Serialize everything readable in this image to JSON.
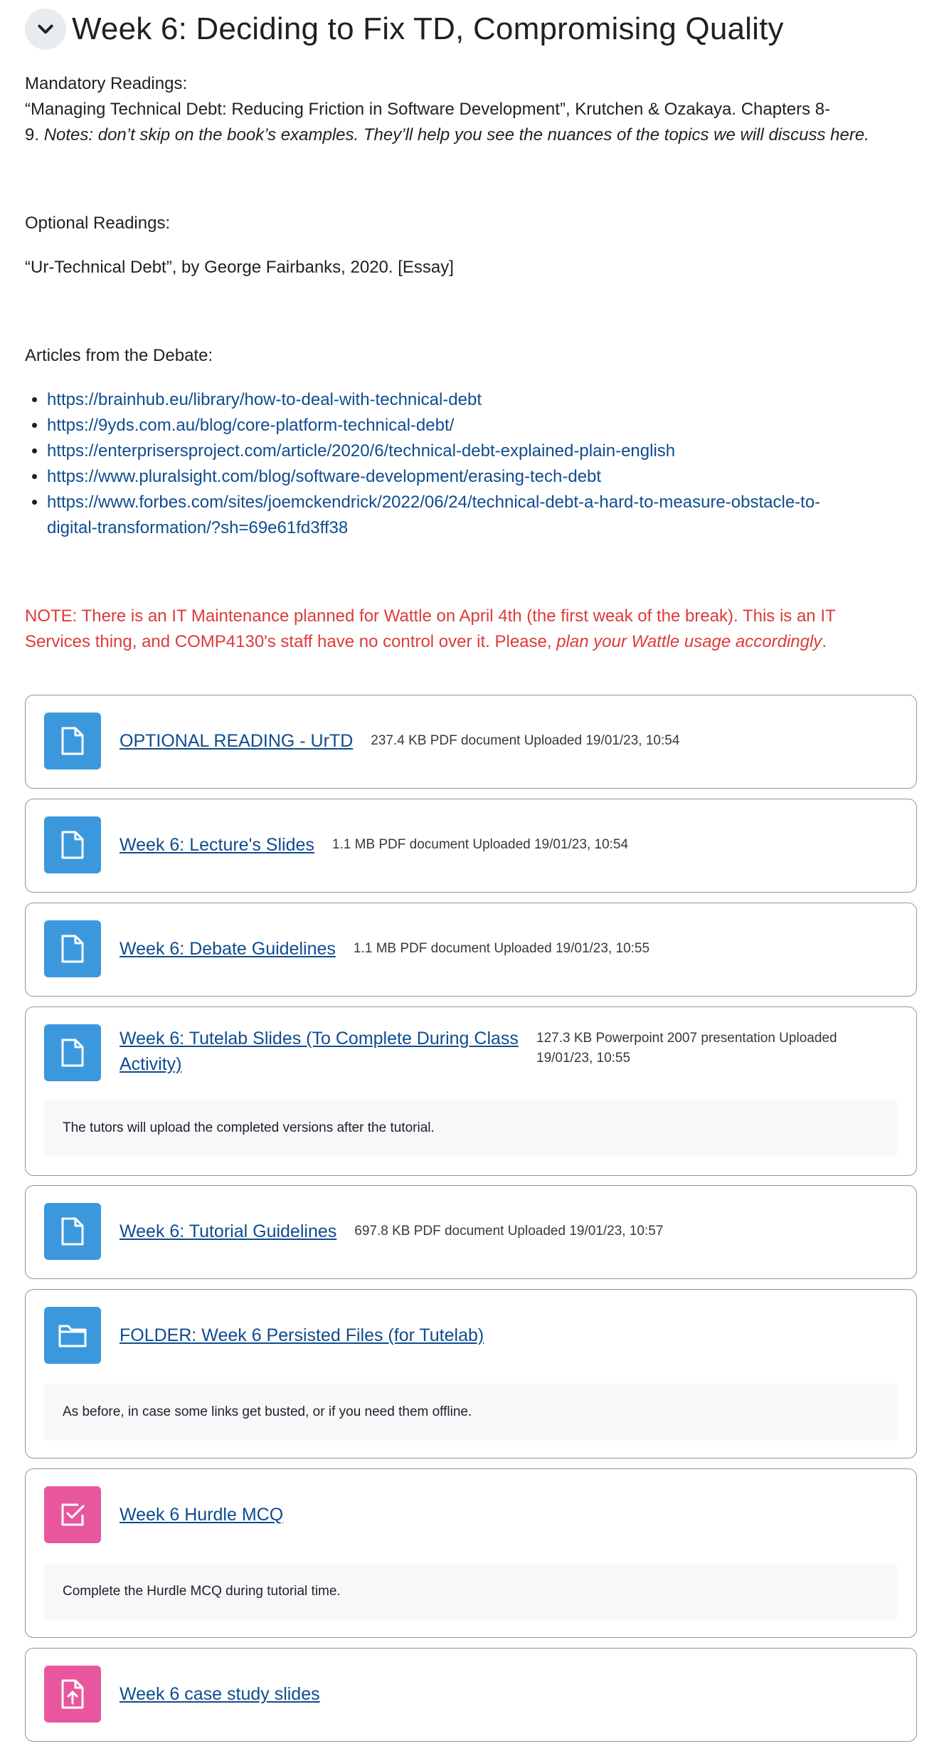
{
  "section": {
    "title": "Week 6: Deciding to Fix TD, Compromising Quality"
  },
  "mandatory": {
    "heading": "Mandatory Readings:",
    "line1": "“Managing Technical Debt: Reducing Friction in Software Development”, Krutchen & Ozakaya. Chapters 8-",
    "line2_prefix": "9. ",
    "line2_note": "Notes: don’t skip on the book’s examples. They’ll help you see the nuances of the topics we will discuss here."
  },
  "optional": {
    "heading": "Optional Readings:",
    "item": "“Ur-Technical Debt”, by George Fairbanks, 2020. [Essay]"
  },
  "debate": {
    "heading": "Articles from the Debate:",
    "links": [
      {
        "line1": "https://brainhub.eu/library/how-to-deal-with-technical-debt",
        "line2": ""
      },
      {
        "line1": "https://9yds.com.au/blog/core-platform-technical-debt/",
        "line2": ""
      },
      {
        "line1": "https://enterprisersproject.com/article/2020/6/technical-debt-explained-plain-english",
        "line2": ""
      },
      {
        "line1": "https://www.pluralsight.com/blog/software-development/erasing-tech-debt",
        "line2": ""
      },
      {
        "line1": "https://www.forbes.com/sites/joemckendrick/2022/06/24/technical-debt-a-hard-to-measure-obstacle-to-",
        "line2": "digital-transformation/?sh=69e61fd3ff38"
      }
    ]
  },
  "note": {
    "line1": "NOTE: There is an IT Maintenance planned for Wattle on April 4th (the first weak of the break). This is an IT",
    "line2_prefix": "Services thing, and COMP4130's staff have no control over it. Please, ",
    "line2_italic": "plan your Wattle usage accordingly",
    "line2_suffix": "."
  },
  "activities": [
    {
      "name": "OPTIONAL READING - UrTD",
      "meta": "237.4 KB PDF document Uploaded 19/01/23, 10:54",
      "icon": "file-icon"
    },
    {
      "name": "Week 6: Lecture's Slides",
      "meta": "1.1 MB PDF document Uploaded 19/01/23, 10:54",
      "icon": "file-icon"
    },
    {
      "name": "Week 6: Debate Guidelines",
      "meta": "1.1 MB PDF document Uploaded 19/01/23, 10:55",
      "icon": "file-icon"
    },
    {
      "name_line1": "Week 6: Tutelab Slides (To Complete During Class",
      "name_line2": "Activity)",
      "meta_line1": "127.3 KB Powerpoint 2007 presentation Uploaded",
      "meta_line2": "19/01/23, 10:55",
      "description": "The tutors will upload the completed versions after the tutorial.",
      "icon": "file-icon"
    },
    {
      "name": "Week 6: Tutorial Guidelines",
      "meta": "697.8 KB PDF document Uploaded 19/01/23, 10:57",
      "icon": "file-icon"
    },
    {
      "name": "FOLDER: Week 6 Persisted Files (for Tutelab)",
      "description": "As before, in case some links get busted, or if you need them offline.",
      "icon": "folder-icon"
    },
    {
      "name": "Week 6 Hurdle MCQ",
      "description": "Complete the Hurdle MCQ during tutorial time.",
      "icon": "quiz-checkbox-icon"
    },
    {
      "name": "Week 6 case study slides",
      "icon": "assignment-upload-icon"
    }
  ],
  "colors": {
    "link": "#0f4c8f",
    "note": "#dd3b3b",
    "resource_icon_bg": "#3c98dd",
    "assessment_icon_bg": "#e8579e"
  }
}
